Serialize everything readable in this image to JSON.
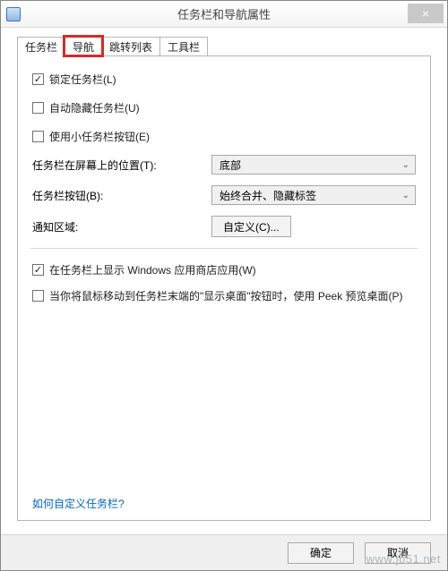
{
  "window": {
    "title": "任务栏和导航属性"
  },
  "tabs": [
    {
      "label": "任务栏"
    },
    {
      "label": "导航"
    },
    {
      "label": "跳转列表"
    },
    {
      "label": "工具栏"
    }
  ],
  "checkboxes": {
    "lock": {
      "label": "锁定任务栏(L)",
      "checked": true
    },
    "autohide": {
      "label": "自动隐藏任务栏(U)",
      "checked": false
    },
    "small": {
      "label": "使用小任务栏按钮(E)",
      "checked": false
    },
    "showstore": {
      "label": "在任务栏上显示 Windows 应用商店应用(W)",
      "checked": true
    },
    "peek": {
      "label": "当你将鼠标移动到任务栏末端的\"显示桌面\"按钮时，使用 Peek 预览桌面(P)",
      "checked": false
    }
  },
  "selects": {
    "position": {
      "label": "任务栏在屏幕上的位置(T):",
      "value": "底部"
    },
    "buttons": {
      "label": "任务栏按钮(B):",
      "value": "始终合并、隐藏标签"
    }
  },
  "notifyarea": {
    "label": "通知区域:",
    "button": "自定义(C)..."
  },
  "link": "如何自定义任务栏?",
  "footer": {
    "ok": "确定",
    "cancel": "取消"
  },
  "watermark": "www.jb51.net"
}
